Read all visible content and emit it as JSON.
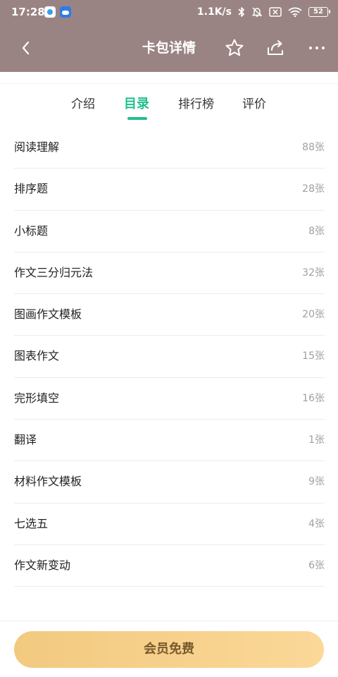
{
  "status_bar": {
    "time": "17:28",
    "network_speed": "1.1K/s",
    "battery_level": "52",
    "icons": [
      "app-icon",
      "cloud-app-icon",
      "bluetooth-icon",
      "mute-bell-icon",
      "no-sim-icon",
      "wifi-icon",
      "battery-icon"
    ]
  },
  "header": {
    "title": "卡包详情",
    "icons": [
      "back-arrow-icon",
      "star-icon",
      "share-icon",
      "more-icon"
    ]
  },
  "tabs": [
    {
      "label": "介绍",
      "active": false
    },
    {
      "label": "目录",
      "active": true
    },
    {
      "label": "排行榜",
      "active": false
    },
    {
      "label": "评价",
      "active": false
    }
  ],
  "catalog": [
    {
      "name": "阅读理解",
      "count": "88张"
    },
    {
      "name": "排序题",
      "count": "28张"
    },
    {
      "name": "小标题",
      "count": "8张"
    },
    {
      "name": "作文三分归元法",
      "count": "32张"
    },
    {
      "name": "图画作文模板",
      "count": "20张"
    },
    {
      "name": "图表作文",
      "count": "15张"
    },
    {
      "name": "完形填空",
      "count": "16张"
    },
    {
      "name": "翻译",
      "count": "1张"
    },
    {
      "name": "材料作文模板",
      "count": "9张"
    },
    {
      "name": "七选五",
      "count": "4张"
    },
    {
      "name": "作文新变动",
      "count": "6张"
    }
  ],
  "bottom": {
    "button_label": "会员免费"
  },
  "colors": {
    "header_bg": "#9a8483",
    "accent": "#1fbf8f",
    "button_gradient_start": "#f2c97f",
    "button_gradient_end": "#fbd898",
    "button_text": "#7a5a2e"
  }
}
